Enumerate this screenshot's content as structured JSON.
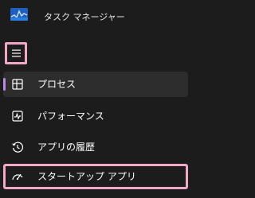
{
  "app": {
    "title": "タスク マネージャー",
    "icon": "task-manager-icon"
  },
  "menu_button": {
    "icon": "hamburger-icon"
  },
  "nav": {
    "items": [
      {
        "label": "プロセス",
        "icon": "processes-icon",
        "selected": true
      },
      {
        "label": "パフォーマンス",
        "icon": "performance-icon",
        "selected": false
      },
      {
        "label": "アプリの履歴",
        "icon": "app-history-icon",
        "selected": false
      },
      {
        "label": "スタートアップ アプリ",
        "icon": "startup-apps-icon",
        "selected": false
      }
    ]
  },
  "colors": {
    "background": "#1c1c1c",
    "selected_background": "#2d2d2d",
    "selection_indicator": "#b88ae0",
    "highlight_border": "#f3a7c7"
  }
}
